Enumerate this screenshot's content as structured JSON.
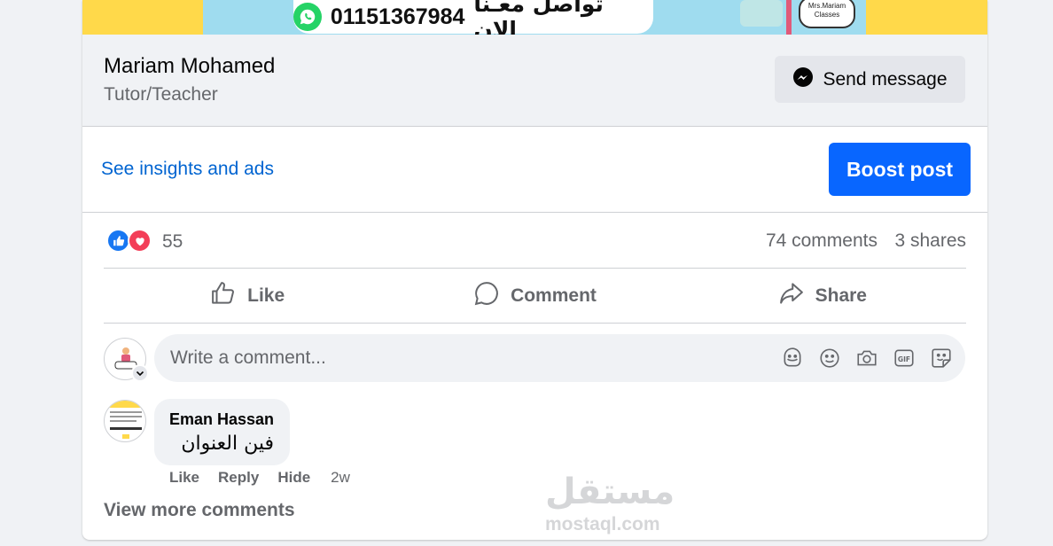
{
  "banner": {
    "phone": "01151367984",
    "arabic_text": "تواصل معـنا الان",
    "bubble_text": "Mrs.Mariam Classes"
  },
  "page_header": {
    "name": "Mariam Mohamed",
    "category": "Tutor/Teacher",
    "send_message_label": "Send message"
  },
  "insights": {
    "link_label": "See insights and ads",
    "boost_label": "Boost post"
  },
  "reactions": {
    "count": "55",
    "comments_label": "74 comments",
    "shares_label": "3 shares"
  },
  "actions": {
    "like": "Like",
    "comment": "Comment",
    "share": "Share"
  },
  "composer": {
    "placeholder": "Write a comment...",
    "tools": [
      "avatar-sticker-icon",
      "emoji-icon",
      "camera-icon",
      "gif-icon",
      "sticker-icon"
    ]
  },
  "comment": {
    "author": "Eman Hassan",
    "text": "فين العنوان",
    "like_label": "Like",
    "reply_label": "Reply",
    "hide_label": "Hide",
    "time": "2w"
  },
  "view_more_label": "View more comments",
  "watermark": {
    "arabic": "مستقل",
    "latin": "mostaql.com"
  },
  "colors": {
    "accent_blue": "#0866ff",
    "link_blue": "#0064d1",
    "banner_yellow": "#ffd94a",
    "whatsapp_green": "#25d366",
    "love_red": "#f33e58"
  }
}
